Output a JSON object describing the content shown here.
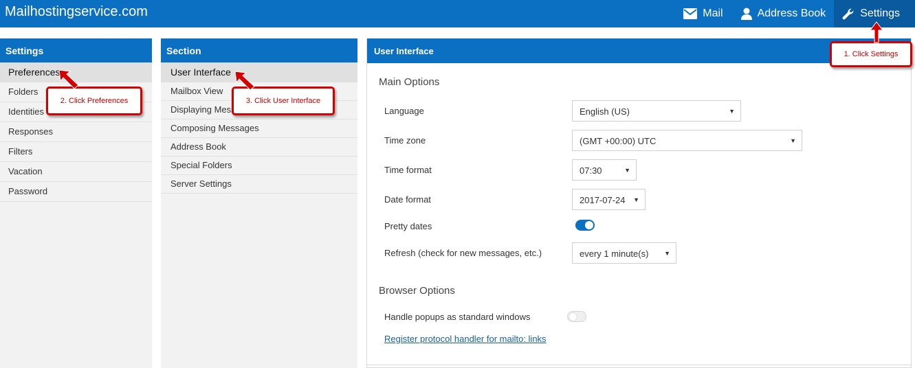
{
  "app": {
    "brand": "Mailhostingservice.com"
  },
  "topnav": {
    "items": [
      {
        "label": "Mail",
        "icon": "envelope-icon"
      },
      {
        "label": "Address Book",
        "icon": "person-icon"
      },
      {
        "label": "Settings",
        "icon": "wrench-icon",
        "active": true
      }
    ]
  },
  "prefs_panel": {
    "title": "Settings",
    "items": [
      "Preferences",
      "Folders",
      "Identities",
      "Responses",
      "Filters",
      "Vacation",
      "Password"
    ]
  },
  "section_panel": {
    "title": "Section",
    "items": [
      "User Interface",
      "Mailbox View",
      "Displaying Messages",
      "Composing Messages",
      "Address Book",
      "Special Folders",
      "Server Settings"
    ]
  },
  "main": {
    "title": "User Interface",
    "main_options": {
      "heading": "Main Options",
      "language_label": "Language",
      "language_value": "English (US)",
      "timezone_label": "Time zone",
      "timezone_value": "(GMT +00:00) UTC",
      "timeformat_label": "Time format",
      "timeformat_value": "07:30",
      "dateformat_label": "Date format",
      "dateformat_value": "2017-07-24",
      "prettydates_label": "Pretty dates",
      "prettydates_on": true,
      "refresh_label": "Refresh (check for new messages, etc.)",
      "refresh_value": "every 1 minute(s)"
    },
    "browser_options": {
      "heading": "Browser Options",
      "popups_label": "Handle popups as standard windows",
      "popups_on": false,
      "protocol_link": "Register protocol handler for mailto: links"
    }
  },
  "callouts": {
    "step1": "1. Click Settings",
    "step2": "2. Click Preferences",
    "step3": "3. Click User Interface"
  },
  "colors": {
    "accent": "#0b6fc2",
    "callout": "#d40000"
  }
}
